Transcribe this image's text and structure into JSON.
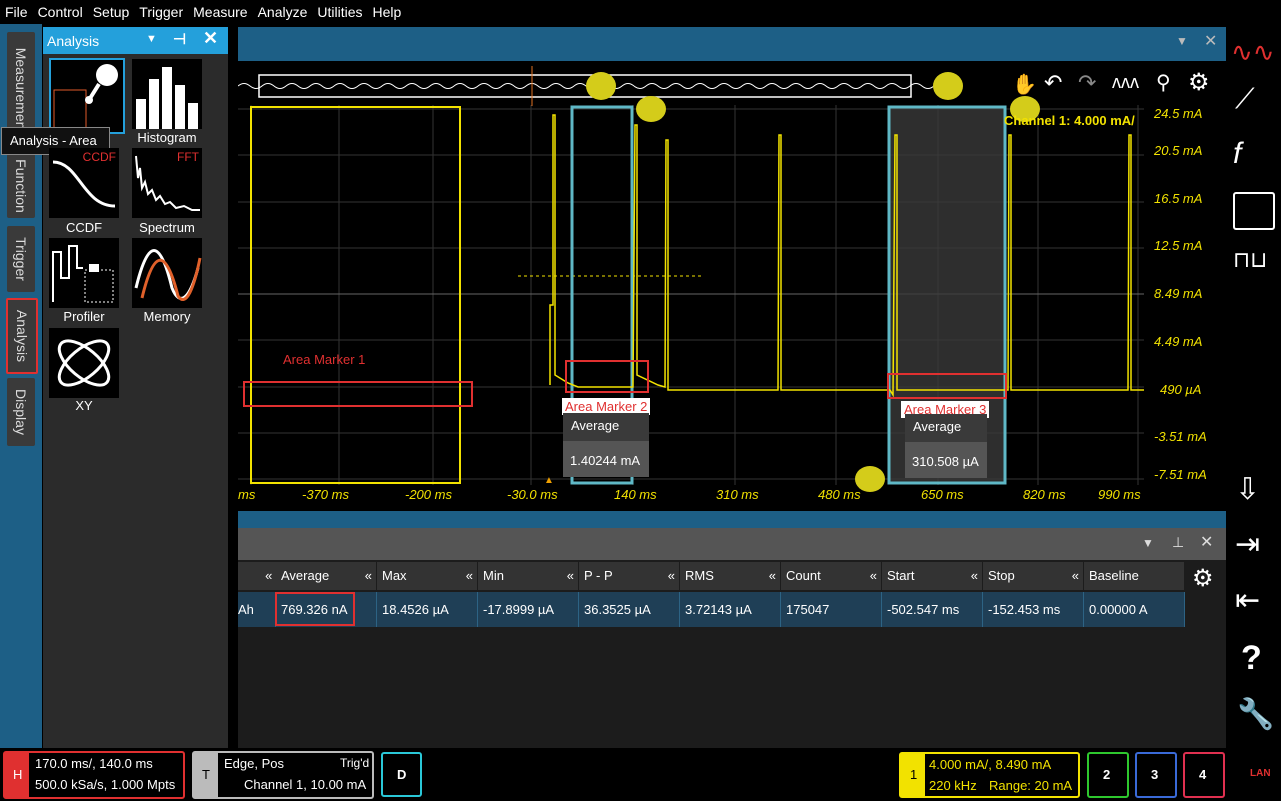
{
  "menu": [
    "File",
    "Control",
    "Setup",
    "Trigger",
    "Measure",
    "Analyze",
    "Utilities",
    "Help"
  ],
  "left_tabs": [
    "Measurements",
    "Function",
    "Trigger",
    "Analysis",
    "Display"
  ],
  "panel": {
    "title": "Analysis",
    "tooltip": "Analysis - Area",
    "tiles": [
      {
        "label": "Histogram"
      },
      {
        "label": "CCDF",
        "tag": "CCDF"
      },
      {
        "label": "Spectrum",
        "tag": "FFT"
      },
      {
        "label": "Profiler"
      },
      {
        "label": "Memory"
      },
      {
        "label": "XY"
      }
    ]
  },
  "scope": {
    "channel_label": "Channel 1:  4.000 mA/",
    "y_labels": [
      "24.5 mA",
      "20.5 mA",
      "16.5 mA",
      "12.5 mA",
      "8.49 mA",
      "4.49 mA",
      "490 µA",
      "-3.51 mA",
      "-7.51 mA"
    ],
    "x_labels": [
      "ms",
      "-370 ms",
      "-200 ms",
      "-30.0 ms",
      "140 ms",
      "310 ms",
      "480 ms",
      "650 ms",
      "820 ms",
      "990 ms"
    ],
    "markers": [
      {
        "label": "Area Marker 1"
      },
      {
        "label": "Area Marker 2",
        "avg_title": "Average",
        "avg_value": "1.40244 mA"
      },
      {
        "label": "Area Marker 3",
        "avg_title": "Average",
        "avg_value": "310.508 µA"
      }
    ],
    "colors": {
      "trace": "#f2e200",
      "marker_red": "#e03030",
      "cyan": "#5fb8c6"
    }
  },
  "table": {
    "headers": [
      "Average",
      "Max",
      "Min",
      "P - P",
      "RMS",
      "Count",
      "Start",
      "Stop",
      "Baseline"
    ],
    "row": {
      "first": "Ah",
      "values": [
        "769.326 nA",
        "18.4526 µA",
        "-17.8999 µA",
        "36.3525 µA",
        "3.72143 µA",
        "175047",
        "-502.547 ms",
        "-152.453 ms",
        "0.00000 A"
      ]
    }
  },
  "status": {
    "h_label": "H",
    "h_line1": "170.0 ms/, 140.0 ms",
    "h_line2": "500.0 kSa/s, 1.000 Mpts",
    "t_label": "T",
    "t_line1": "Edge, Pos",
    "t_trig": "Trig'd",
    "t_line2": "Channel 1, 10.00 mA",
    "d_label": "D",
    "ch1_label": "1",
    "ch1_line1": "4.000 mA/, 8.490 mA",
    "ch1_bw": "220 kHz",
    "ch1_range": "Range: 20 mA",
    "ch2": "2",
    "ch3": "3",
    "ch4": "4",
    "lan": "LAN"
  }
}
